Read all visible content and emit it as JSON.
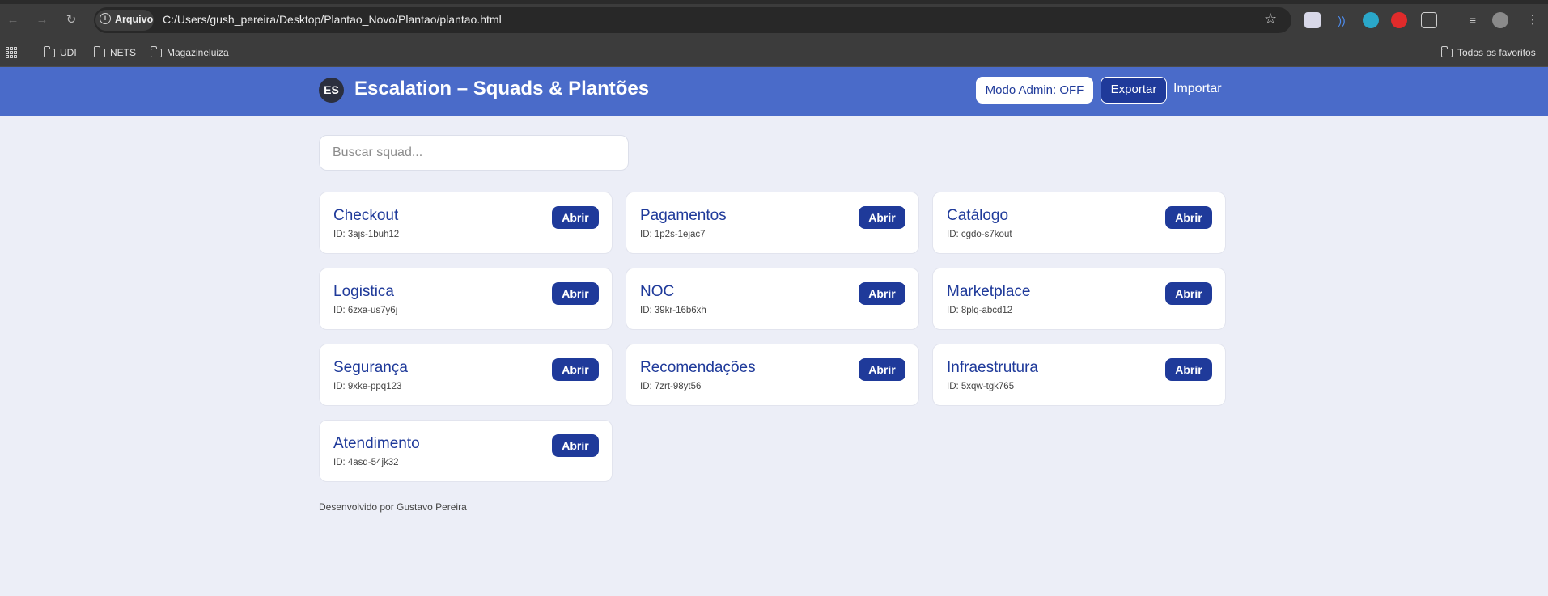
{
  "browser": {
    "chip_label": "Arquivo",
    "url": "C:/Users/gush_pereira/Desktop/Plantao_Novo/Plantao/plantao.html",
    "bookmarks": [
      "UDI",
      "NETS",
      "Magazineluiza"
    ],
    "all_bookmarks": "Todos os favoritos"
  },
  "header": {
    "logo": "ES",
    "title": "Escalation – Squads & Plantões",
    "admin_button": "Modo Admin: OFF",
    "export_button": "Exportar",
    "import_button": "Importar",
    "colors": {
      "header_bg": "#4a6bc9",
      "accent": "#1f3a9a"
    }
  },
  "search": {
    "placeholder": "Buscar squad...",
    "value": ""
  },
  "squads": [
    {
      "name": "Checkout",
      "id": "ID: 3ajs-1buh12",
      "action": "Abrir"
    },
    {
      "name": "Pagamentos",
      "id": "ID: 1p2s-1ejac7",
      "action": "Abrir"
    },
    {
      "name": "Catálogo",
      "id": "ID: cgdo-s7kout",
      "action": "Abrir"
    },
    {
      "name": "Logistica",
      "id": "ID: 6zxa-us7y6j",
      "action": "Abrir"
    },
    {
      "name": "NOC",
      "id": "ID: 39kr-16b6xh",
      "action": "Abrir"
    },
    {
      "name": "Marketplace",
      "id": "ID: 8plq-abcd12",
      "action": "Abrir"
    },
    {
      "name": "Segurança",
      "id": "ID: 9xke-ppq123",
      "action": "Abrir"
    },
    {
      "name": "Recomendações",
      "id": "ID: 7zrt-98yt56",
      "action": "Abrir"
    },
    {
      "name": "Infraestrutura",
      "id": "ID: 5xqw-tgk765",
      "action": "Abrir"
    },
    {
      "name": "Atendimento",
      "id": "ID: 4asd-54jk32",
      "action": "Abrir"
    }
  ],
  "footer": {
    "text": "Desenvolvido por Gustavo Pereira"
  }
}
